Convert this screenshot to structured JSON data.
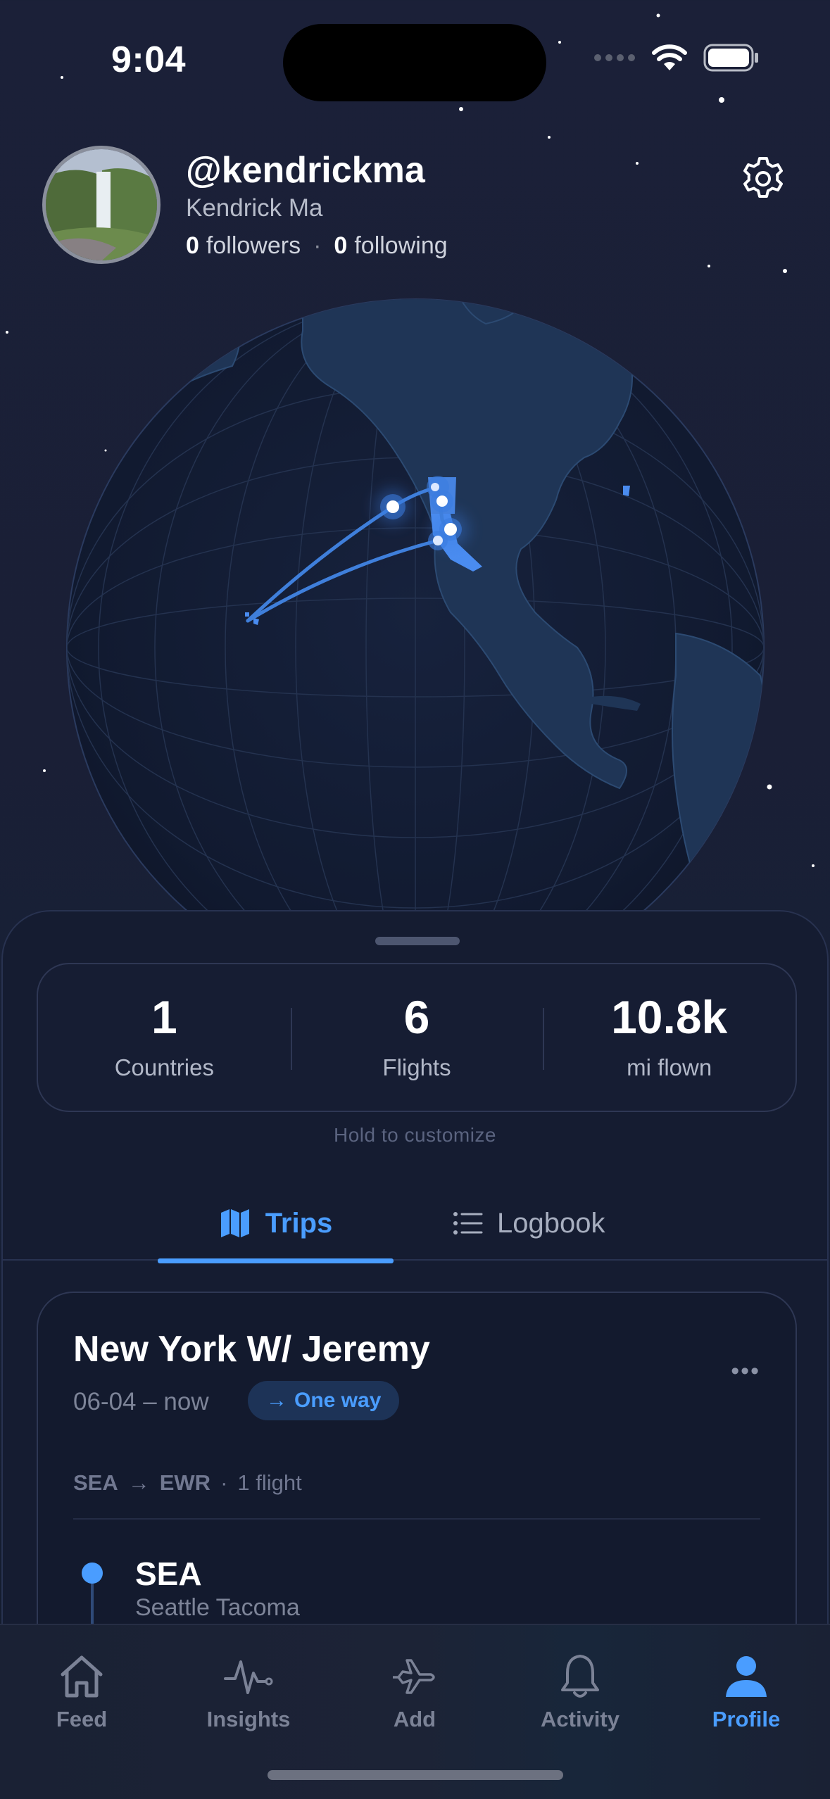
{
  "status_bar": {
    "time": "9:04"
  },
  "profile": {
    "username": "@kendrickma",
    "name": "Kendrick Ma",
    "followers_count": "0",
    "followers_label": "followers",
    "following_count": "0",
    "following_label": "following"
  },
  "stats": [
    {
      "value": "1",
      "label": "Countries"
    },
    {
      "value": "6",
      "label": "Flights"
    },
    {
      "value": "10.8k",
      "label": "mi flown"
    }
  ],
  "stats_hint": "Hold to customize",
  "tabs": {
    "trips": "Trips",
    "logbook": "Logbook",
    "active": "trips"
  },
  "trip": {
    "title": "New York W/ Jeremy",
    "dates": "06-04 – now",
    "badge": "One way",
    "origin": "SEA",
    "destination": "EWR",
    "flight_count": "1 flight",
    "segment": {
      "code": "SEA",
      "name": "Seattle Tacoma"
    }
  },
  "tabbar": [
    {
      "label": "Feed",
      "icon": "house-icon"
    },
    {
      "label": "Insights",
      "icon": "pulse-icon"
    },
    {
      "label": "Add",
      "icon": "airplane-icon"
    },
    {
      "label": "Activity",
      "icon": "bell-icon"
    },
    {
      "label": "Profile",
      "icon": "person-icon",
      "active": true
    }
  ],
  "colors": {
    "accent": "#4a9dff",
    "background": "#1a1f36",
    "sheet": "#151c31"
  }
}
